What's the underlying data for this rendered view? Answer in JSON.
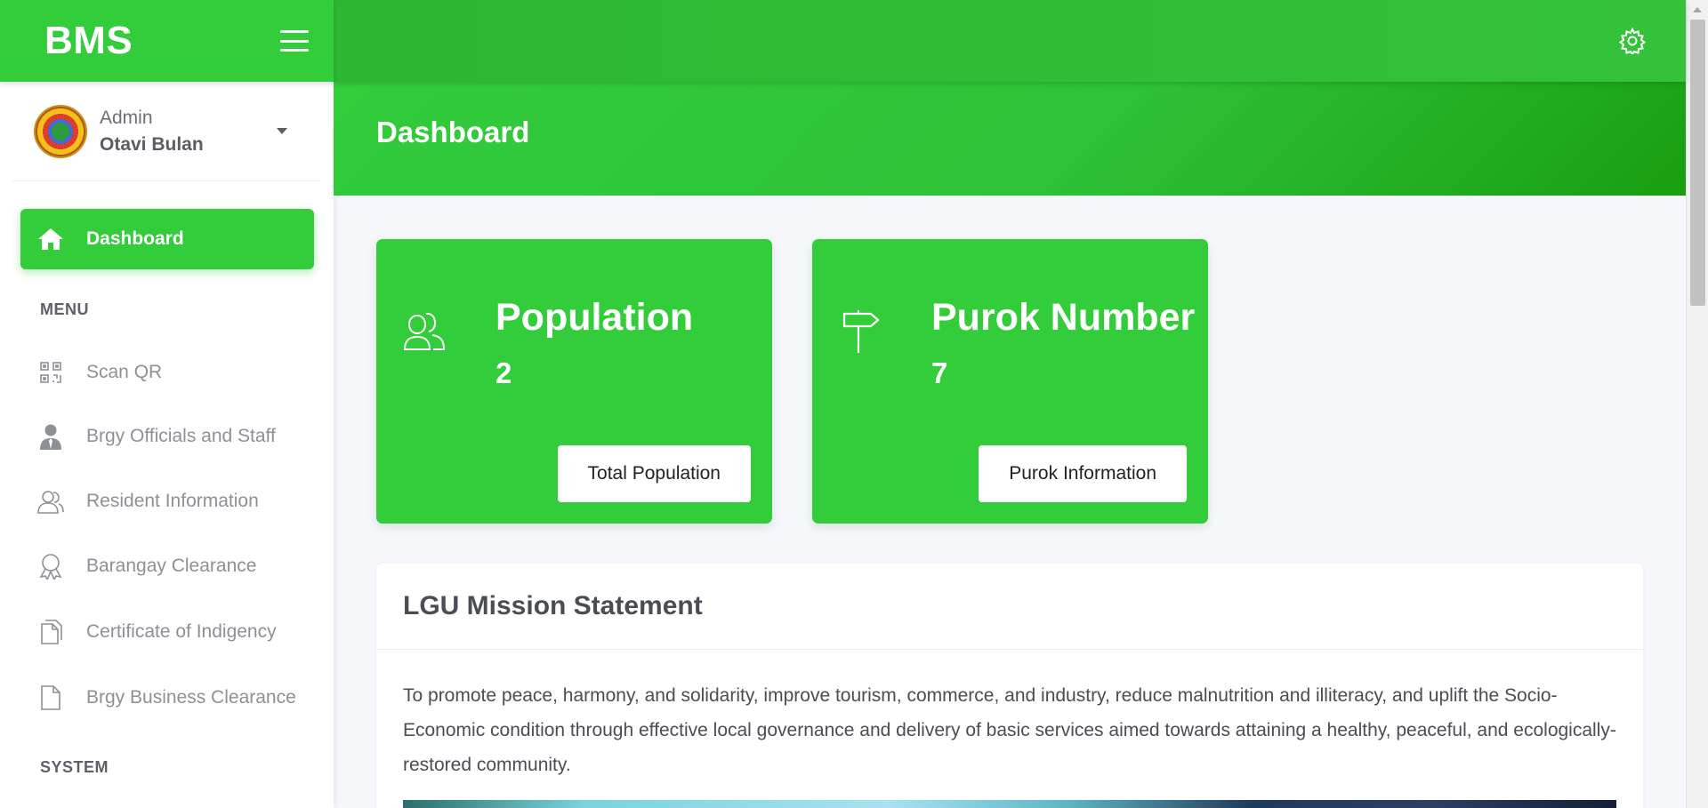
{
  "brand": {
    "logo": "BMS"
  },
  "user": {
    "role": "Admin",
    "name": "Otavi Bulan"
  },
  "nav": {
    "active": {
      "label": "Dashboard",
      "icon": "home-icon"
    },
    "menu_title": "MENU",
    "items": [
      {
        "label": "Scan QR",
        "icon": "qr-code-icon"
      },
      {
        "label": "Brgy Officials and Staff",
        "icon": "user-tie-icon"
      },
      {
        "label": "Resident Information",
        "icon": "users-icon"
      },
      {
        "label": "Barangay Clearance",
        "icon": "award-icon"
      },
      {
        "label": "Certificate of Indigency",
        "icon": "documents-icon"
      },
      {
        "label": "Brgy Business Clearance",
        "icon": "file-icon"
      }
    ],
    "system_title": "SYSTEM"
  },
  "header": {
    "title": "Dashboard"
  },
  "cards": [
    {
      "title": "Population",
      "value": "2",
      "button": "Total Population",
      "icon": "users-outline-icon"
    },
    {
      "title": "Purok Number",
      "value": "7",
      "button": "Purok Information",
      "icon": "signpost-icon"
    }
  ],
  "mission": {
    "title": "LGU Mission Statement",
    "text": "To promote peace, harmony, and solidarity, improve tourism, commerce, and industry, reduce malnutrition and illiteracy, and uplift the Socio-Economic condition through effective local governance and delivery of basic services aimed towards attaining a healthy, peaceful, and ecologically-restored community."
  },
  "colors": {
    "accent": "#33cc3b",
    "accent_dark": "#1a9e10",
    "muted_text": "#8d9096"
  }
}
